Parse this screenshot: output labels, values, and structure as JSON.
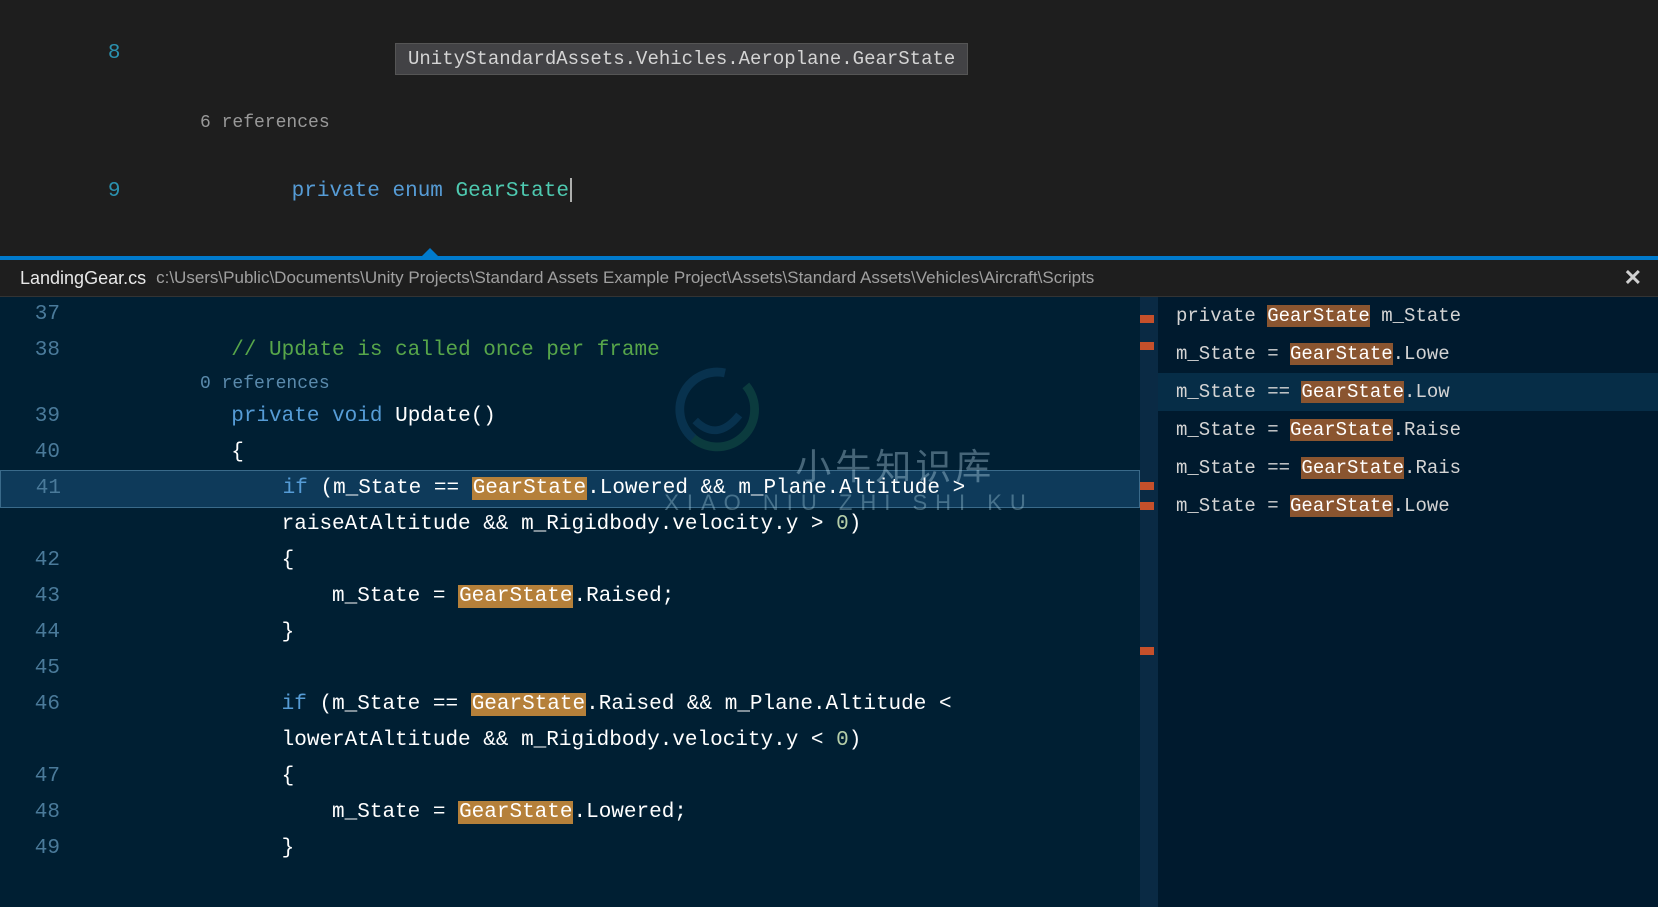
{
  "top": {
    "lines": [
      {
        "num": "8",
        "codelens": "",
        "code": ""
      },
      {
        "num": "",
        "codelens": "6 references",
        "code": ""
      },
      {
        "num": "9",
        "codelens": "",
        "tokens": [
          {
            "t": "            ",
            "c": ""
          },
          {
            "t": "private",
            "c": "kw"
          },
          {
            "t": " ",
            "c": ""
          },
          {
            "t": "enum",
            "c": "kw"
          },
          {
            "t": " ",
            "c": ""
          },
          {
            "t": "GearState",
            "c": "type"
          }
        ]
      }
    ],
    "tooltip": "UnityStandardAssets.Vehicles.Aeroplane.GearState"
  },
  "peek": {
    "filename": "LandingGear.cs",
    "filepath": "c:\\Users\\Public\\Documents\\Unity Projects\\Standard Assets Example Project\\Assets\\Standard Assets\\Vehicles\\Aircraft\\Scripts",
    "codelens_refs": "0 references",
    "lines": [
      {
        "num": "37",
        "tokens": []
      },
      {
        "num": "38",
        "tokens": [
          {
            "t": "            ",
            "c": ""
          },
          {
            "t": "// Update is called once per frame",
            "c": "cmt"
          }
        ]
      },
      {
        "num": "",
        "codelens": "0 references"
      },
      {
        "num": "39",
        "tokens": [
          {
            "t": "            ",
            "c": ""
          },
          {
            "t": "private",
            "c": "kw"
          },
          {
            "t": " ",
            "c": ""
          },
          {
            "t": "void",
            "c": "kw"
          },
          {
            "t": " ",
            "c": ""
          },
          {
            "t": "Update()",
            "c": "white"
          }
        ]
      },
      {
        "num": "40",
        "tokens": [
          {
            "t": "            {",
            "c": "white"
          }
        ]
      },
      {
        "num": "41",
        "current": true,
        "tokens": [
          {
            "t": "                ",
            "c": ""
          },
          {
            "t": "if",
            "c": "kw"
          },
          {
            "t": " (m_State == ",
            "c": "white"
          },
          {
            "t": "GearState",
            "c": "hl"
          },
          {
            "t": ".Lowered && m_Plane.Altitude > ",
            "c": "white"
          }
        ]
      },
      {
        "num": "",
        "tokens": [
          {
            "t": "                raiseAtAltitude && m_Rigidbody.velocity.y > ",
            "c": "white"
          },
          {
            "t": "0",
            "c": "num"
          },
          {
            "t": ")",
            "c": "white"
          }
        ]
      },
      {
        "num": "42",
        "tokens": [
          {
            "t": "                {",
            "c": "white"
          }
        ]
      },
      {
        "num": "43",
        "tokens": [
          {
            "t": "                    m_State = ",
            "c": "white"
          },
          {
            "t": "GearState",
            "c": "hl"
          },
          {
            "t": ".Raised;",
            "c": "white"
          }
        ]
      },
      {
        "num": "44",
        "tokens": [
          {
            "t": "                }",
            "c": "white"
          }
        ]
      },
      {
        "num": "45",
        "tokens": []
      },
      {
        "num": "46",
        "tokens": [
          {
            "t": "                ",
            "c": ""
          },
          {
            "t": "if",
            "c": "kw"
          },
          {
            "t": " (m_State == ",
            "c": "white"
          },
          {
            "t": "GearState",
            "c": "hl"
          },
          {
            "t": ".Raised && m_Plane.Altitude < ",
            "c": "white"
          }
        ]
      },
      {
        "num": "",
        "tokens": [
          {
            "t": "                lowerAtAltitude && m_Rigidbody.velocity.y < ",
            "c": "white"
          },
          {
            "t": "0",
            "c": "num"
          },
          {
            "t": ")",
            "c": "white"
          }
        ]
      },
      {
        "num": "47",
        "tokens": [
          {
            "t": "                {",
            "c": "white"
          }
        ]
      },
      {
        "num": "48",
        "tokens": [
          {
            "t": "                    m_State = ",
            "c": "white"
          },
          {
            "t": "GearState",
            "c": "hl"
          },
          {
            "t": ".Lowered;",
            "c": "white"
          }
        ]
      },
      {
        "num": "49",
        "tokens": [
          {
            "t": "                }",
            "c": "white"
          }
        ]
      }
    ],
    "refs": [
      {
        "pre": "private ",
        "hl": "GearState",
        "post": " m_State"
      },
      {
        "pre": "m_State = ",
        "hl": "GearState",
        "post": ".Lowe"
      },
      {
        "pre": "m_State == ",
        "hl": "GearState",
        "post": ".Low",
        "sel": true
      },
      {
        "pre": "m_State = ",
        "hl": "GearState",
        "post": ".Raise"
      },
      {
        "pre": "m_State == ",
        "hl": "GearState",
        "post": ".Rais"
      },
      {
        "pre": "m_State = ",
        "hl": "GearState",
        "post": ".Lowe"
      }
    ],
    "ov_marks": [
      18,
      45,
      185,
      205,
      350
    ]
  },
  "watermark": {
    "cn": "小牛知识库",
    "en": "XIAO NIU ZHI SHI KU"
  }
}
